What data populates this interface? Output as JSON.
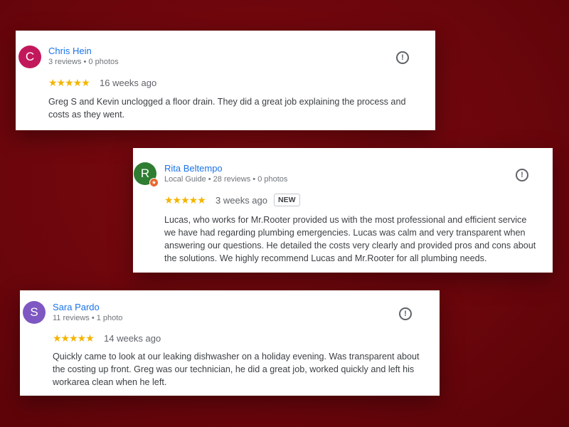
{
  "reviews": [
    {
      "avatar_letter": "C",
      "avatar_color": "#c2185b",
      "name": "Chris Hein",
      "meta": "3 reviews • 0 photos",
      "stars": "★★★★★",
      "rating": 5,
      "age": "16 weeks ago",
      "text": "Greg S and Kevin unclogged a floor drain. They did a great job explaining the process and costs as they went.",
      "flag_icon": "report-flag-icon"
    },
    {
      "avatar_letter": "R",
      "avatar_color": "#2e7d32",
      "name": "Rita Beltempo",
      "meta": "Local Guide • 28 reviews • 0 photos",
      "stars": "★★★★★",
      "rating": 5,
      "age": "3 weeks ago",
      "new_label": "NEW",
      "text": "Lucas, who works for Mr.Rooter provided us with the most professional and efficient service we have had regarding plumbing emergencies. Lucas was calm and very transparent when answering our questions. He detailed the costs very clearly and provided pros and cons about the solutions. We highly recommend Lucas and Mr.Rooter for all plumbing needs.",
      "flag_icon": "report-flag-icon"
    },
    {
      "avatar_letter": "S",
      "avatar_color": "#7e57c2",
      "name": "Sara Pardo",
      "meta": "11 reviews • 1 photo",
      "stars": "★★★★★",
      "rating": 5,
      "age": "14 weeks ago",
      "text": "Quickly came to look at our leaking dishwasher on a holiday evening. Was transparent about the costing up front. Greg was our technician, he did a great job, worked quickly and left his workarea clean when he left.",
      "flag_icon": "report-flag-icon"
    }
  ],
  "accent": {
    "background": "#6a060c",
    "link": "#1a73e8",
    "star": "#f4b400",
    "local_guide_badge": "#e8632b"
  }
}
